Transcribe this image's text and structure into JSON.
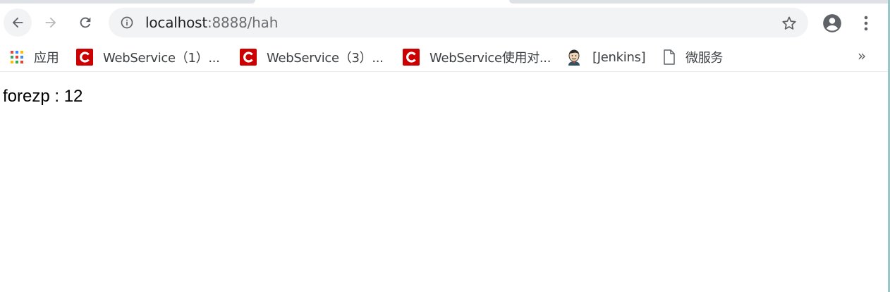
{
  "browser": {
    "omnibox": {
      "url_host": "localhost",
      "url_rest": ":8888/hah"
    },
    "icons": {
      "back": "back-arrow-icon",
      "forward": "forward-arrow-icon",
      "reload": "reload-icon",
      "info": "info-icon",
      "star": "bookmark-star-icon",
      "account": "account-icon",
      "menu": "kebab-menu-icon"
    }
  },
  "bookmarks": {
    "items": [
      {
        "label": "应用",
        "icon": "apps-grid-icon"
      },
      {
        "label": "WebService（1）...",
        "icon": "csdn-c-icon"
      },
      {
        "label": "WebService（3）...",
        "icon": "csdn-c-icon"
      },
      {
        "label": "WebService使用对...",
        "icon": "csdn-c-icon"
      },
      {
        "label": "[Jenkins]",
        "icon": "jenkins-icon"
      },
      {
        "label": "微服务",
        "icon": "page-icon"
      }
    ],
    "overflow": "»"
  },
  "page": {
    "text": "forezp : 12"
  },
  "colors": {
    "omnibox_bg": "#f1f3f4",
    "csdn_red": "#cc0000",
    "icon_gray": "#5f6368"
  }
}
